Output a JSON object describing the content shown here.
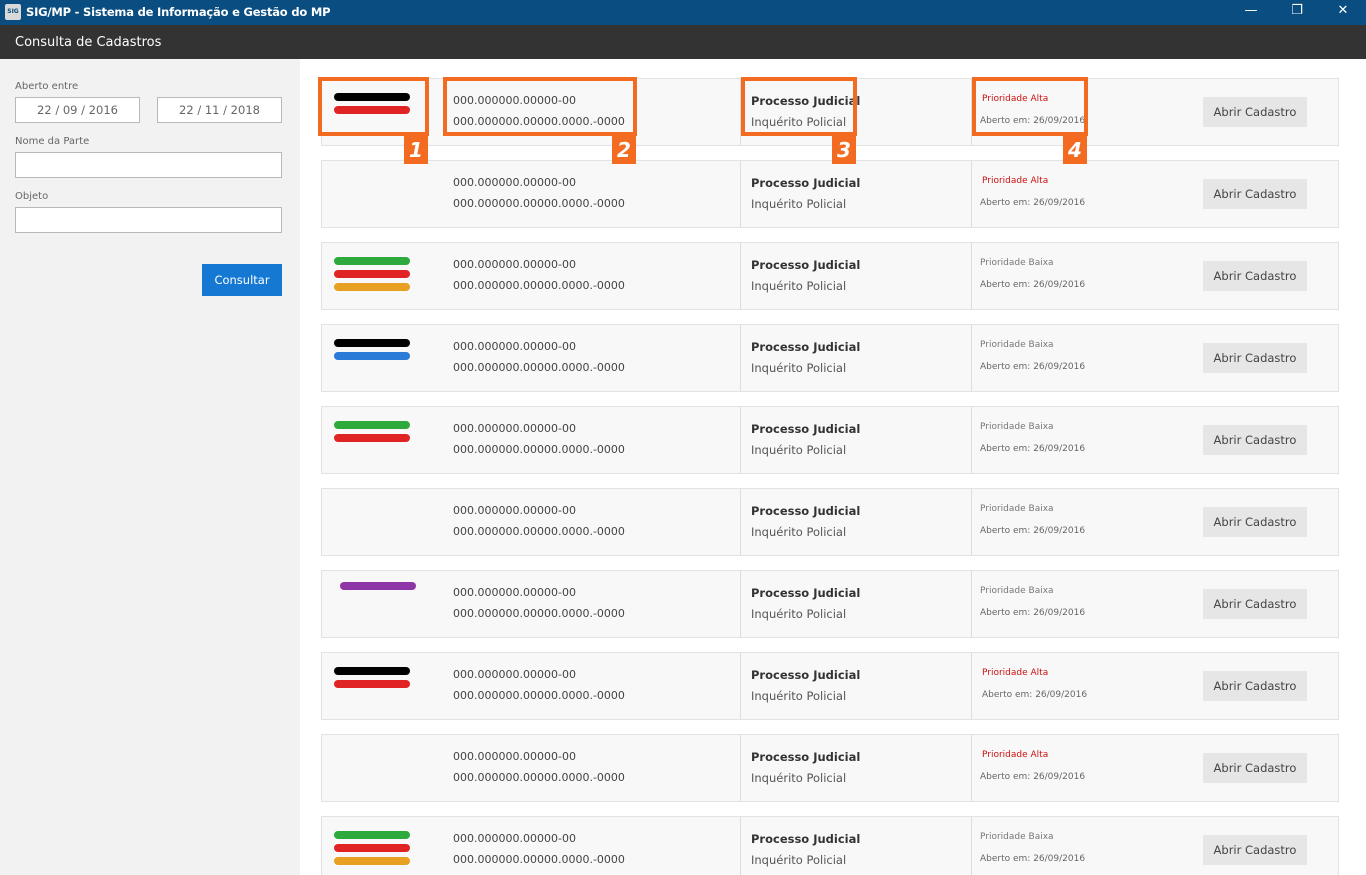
{
  "window": {
    "app_icon_text": "SIG",
    "title": "SIG/MP - Sistema de Informação e Gestão do MP",
    "minimize": "—",
    "maximize": "❐",
    "close": "✕"
  },
  "page": {
    "title": "Consulta de Cadastros"
  },
  "filters": {
    "aberto_label": "Aberto entre",
    "date_from": "22 / 09 / 2016",
    "date_to": "22 / 11 / 2018",
    "nome_label": "Nome da Parte",
    "nome_value": "",
    "objeto_label": "Objeto",
    "objeto_value": "",
    "consultar_label": "Consultar"
  },
  "colors": {
    "black": "#000000",
    "red": "#e02424",
    "green": "#2eaa3c",
    "orange": "#e8a023",
    "blue": "#2a7ad8",
    "purple": "#8e35a8",
    "callout": "#f26b21",
    "priority_high": "#cc1111"
  },
  "records": [
    {
      "bars": [
        "black",
        "red"
      ],
      "num1": "000.000000.00000-00",
      "num2": "000.000000.00000.0000.-0000",
      "tipo": "Processo Judicial",
      "subtipo": "Inquérito Policial",
      "prioridade": "Prioridade Alta",
      "alta": true,
      "aberto": "Aberto em: 26/09/2016",
      "action": "Abrir Cadastro"
    },
    {
      "bars": [],
      "num1": "000.000000.00000-00",
      "num2": "000.000000.00000.0000.-0000",
      "tipo": "Processo Judicial",
      "subtipo": "Inquérito Policial",
      "prioridade": "Prioridade Alta",
      "alta": true,
      "aberto": "Aberto em: 26/09/2016",
      "action": "Abrir Cadastro"
    },
    {
      "bars": [
        "green",
        "red",
        "orange"
      ],
      "num1": "000.000000.00000-00",
      "num2": "000.000000.00000.0000.-0000",
      "tipo": "Processo Judicial",
      "subtipo": "Inquérito Policial",
      "prioridade": "Prioridade Baixa",
      "alta": false,
      "aberto": "Aberto em: 26/09/2016",
      "action": "Abrir Cadastro"
    },
    {
      "bars": [
        "black",
        "blue"
      ],
      "num1": "000.000000.00000-00",
      "num2": "000.000000.00000.0000.-0000",
      "tipo": "Processo Judicial",
      "subtipo": "Inquérito Policial",
      "prioridade": "Prioridade Baixa",
      "alta": false,
      "aberto": "Aberto em: 26/09/2016",
      "action": "Abrir Cadastro"
    },
    {
      "bars": [
        "green",
        "red"
      ],
      "num1": "000.000000.00000-00",
      "num2": "000.000000.00000.0000.-0000",
      "tipo": "Processo Judicial",
      "subtipo": "Inquérito Policial",
      "prioridade": "Prioridade Baixa",
      "alta": false,
      "aberto": "Aberto em: 26/09/2016",
      "action": "Abrir Cadastro"
    },
    {
      "bars": [],
      "num1": "000.000000.00000-00",
      "num2": "000.000000.00000.0000.-0000",
      "tipo": "Processo Judicial",
      "subtipo": "Inquérito Policial",
      "prioridade": "Prioridade Baixa",
      "alta": false,
      "aberto": "Aberto em: 26/09/2016",
      "action": "Abrir Cadastro"
    },
    {
      "bars": [
        "purple"
      ],
      "num1": "000.000000.00000-00",
      "num2": "000.000000.00000.0000.-0000",
      "tipo": "Processo Judicial",
      "subtipo": "Inquérito Policial",
      "prioridade": "Prioridade Baixa",
      "alta": false,
      "aberto": "Aberto em: 26/09/2016",
      "action": "Abrir Cadastro"
    },
    {
      "bars": [
        "black",
        "red"
      ],
      "num1": "000.000000.00000-00",
      "num2": "000.000000.00000.0000.-0000",
      "tipo": "Processo Judicial",
      "subtipo": "Inquérito Policial",
      "prioridade": "Prioridade Alta",
      "alta": true,
      "aberto": "Aberto em: 26/09/2016",
      "action": "Abrir Cadastro"
    },
    {
      "bars": [],
      "num1": "000.000000.00000-00",
      "num2": "000.000000.00000.0000.-0000",
      "tipo": "Processo Judicial",
      "subtipo": "Inquérito Policial",
      "prioridade": "Prioridade Alta",
      "alta": true,
      "aberto": "Aberto em: 26/09/2016",
      "action": "Abrir Cadastro"
    },
    {
      "bars": [
        "green",
        "red",
        "orange"
      ],
      "num1": "000.000000.00000-00",
      "num2": "000.000000.00000.0000.-0000",
      "tipo": "Processo Judicial",
      "subtipo": "Inquérito Policial",
      "prioridade": "Prioridade Baixa",
      "alta": false,
      "aberto": "Aberto em: 26/09/2016",
      "action": "Abrir Cadastro"
    }
  ],
  "callouts": [
    {
      "label": "1"
    },
    {
      "label": "2"
    },
    {
      "label": "3"
    },
    {
      "label": "4"
    }
  ]
}
